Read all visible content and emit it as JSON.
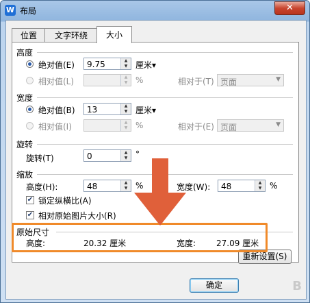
{
  "window": {
    "title": "布局",
    "app_icon_letter": "W",
    "close_label": "✕"
  },
  "tabs": [
    {
      "label": "位置",
      "active": false
    },
    {
      "label": "文字环绕",
      "active": false
    },
    {
      "label": "大小",
      "active": true
    }
  ],
  "height_section": {
    "title": "高度",
    "absolute": {
      "label": "绝对值(E)",
      "value": "9.75",
      "unit": "厘米▾"
    },
    "relative": {
      "label": "相对值(L)",
      "unit": "%",
      "relative_to_label": "相对于(T)",
      "relative_to_value": "页面"
    }
  },
  "width_section": {
    "title": "宽度",
    "absolute": {
      "label": "绝对值(B)",
      "value": "13",
      "unit": "厘米▾"
    },
    "relative": {
      "label": "相对值(I)",
      "unit": "%",
      "relative_to_label": "相对于(E)",
      "relative_to_value": "页面"
    }
  },
  "rotation_section": {
    "title": "旋转",
    "label": "旋转(T)",
    "value": "0",
    "unit": "°"
  },
  "scale_section": {
    "title": "缩放",
    "height_label": "高度(H):",
    "height_value": "48",
    "height_unit": "%",
    "width_label": "宽度(W):",
    "width_value": "48",
    "width_unit": "%",
    "lock_ratio_label": "锁定纵横比(A)",
    "lock_ratio_checked": true,
    "relative_original_label": "相对原始图片大小(R)",
    "relative_original_checked": true
  },
  "original_size": {
    "title": "原始尺寸",
    "height_label": "高度:",
    "height_value": "20.32 厘米",
    "width_label": "宽度:",
    "width_value": "27.09 厘米"
  },
  "buttons": {
    "reset": "重新设置(S)",
    "ok": "确定"
  },
  "annotation": {
    "arrow_color": "#e0603a",
    "highlight_color": "#f08a2a"
  },
  "watermark": "B"
}
